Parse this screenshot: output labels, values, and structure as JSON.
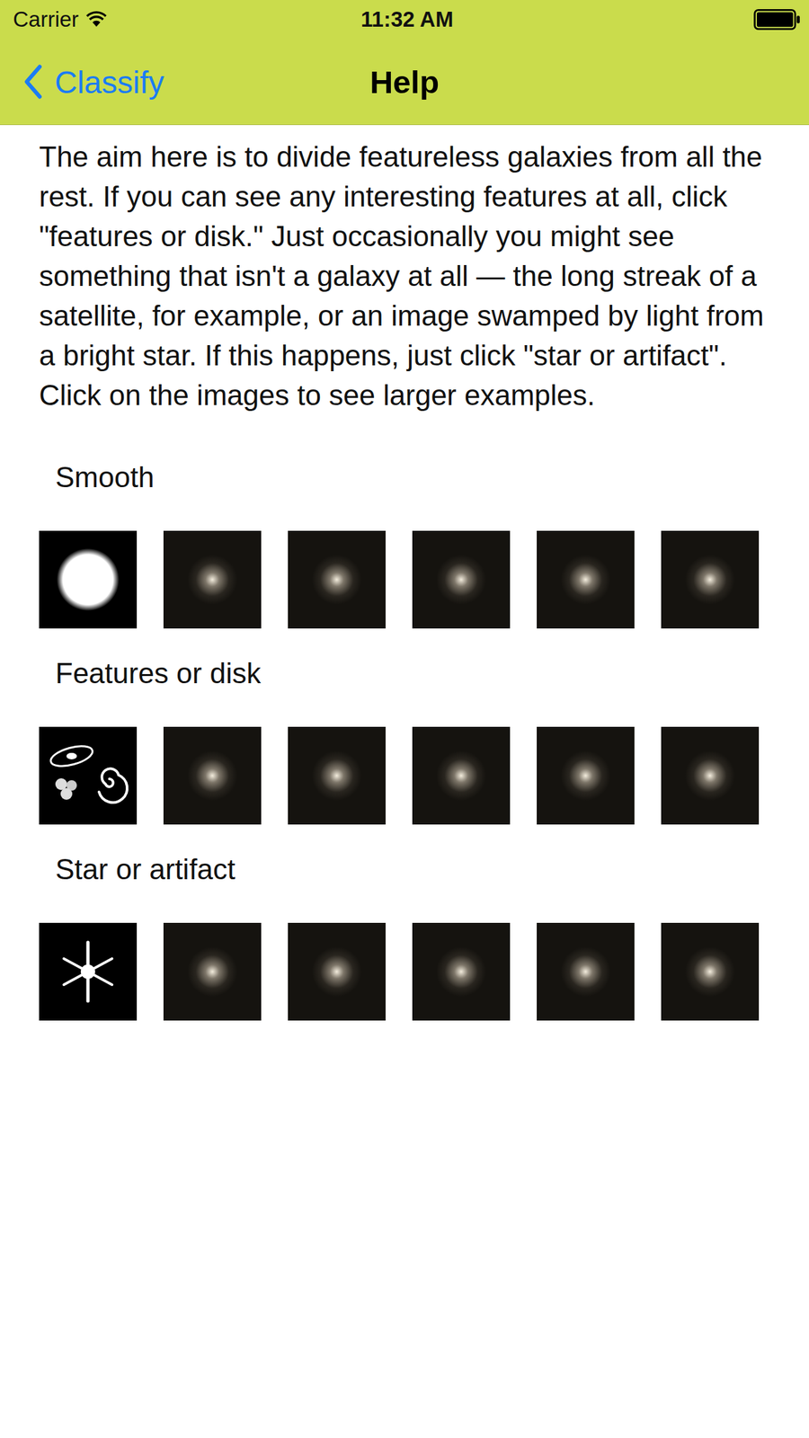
{
  "status_bar": {
    "carrier": "Carrier",
    "time": "11:32 AM"
  },
  "nav": {
    "back": "Classify",
    "title": "Help"
  },
  "intro": "The aim here is to divide featureless galaxies from all the rest. If you can see any interesting features at all, click \"features or disk.\" Just occasionally you might see something that isn't a galaxy at all — the long streak of a satellite, for example, or an image swamped by light from a bright star. If this happens, just click \"star or artifact\". Click on the images to see larger examples.",
  "sections": [
    {
      "title": "Smooth",
      "images": [
        {
          "kind": "diagram"
        },
        {
          "kind": "photo"
        },
        {
          "kind": "photo"
        },
        {
          "kind": "photo"
        },
        {
          "kind": "photo"
        },
        {
          "kind": "photo"
        }
      ]
    },
    {
      "title": "Features or disk",
      "images": [
        {
          "kind": "diagram"
        },
        {
          "kind": "photo"
        },
        {
          "kind": "photo"
        },
        {
          "kind": "photo"
        },
        {
          "kind": "photo"
        },
        {
          "kind": "photo"
        }
      ]
    },
    {
      "title": "Star or artifact",
      "images": [
        {
          "kind": "diagram"
        },
        {
          "kind": "photo"
        },
        {
          "kind": "photo"
        },
        {
          "kind": "photo"
        },
        {
          "kind": "photo"
        },
        {
          "kind": "photo"
        }
      ]
    }
  ]
}
